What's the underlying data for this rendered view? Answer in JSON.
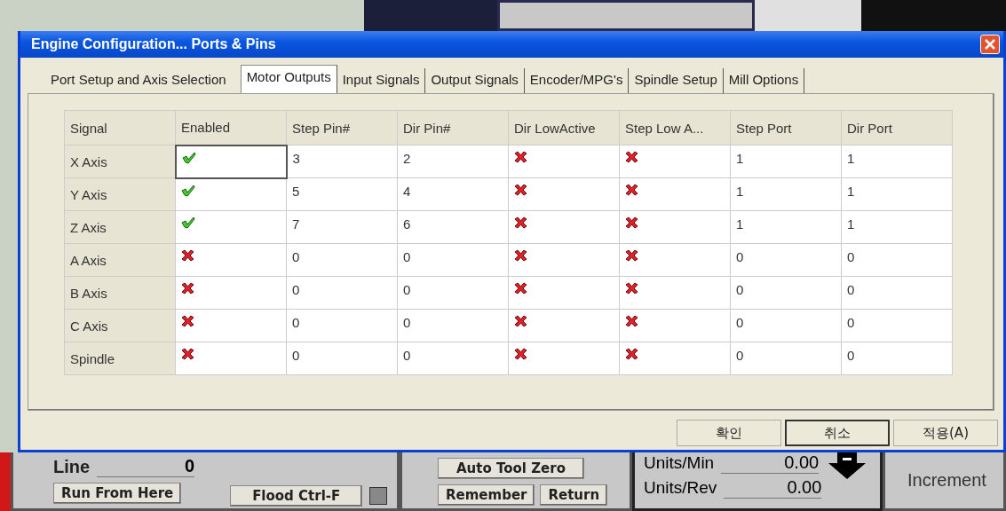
{
  "dialog": {
    "title": "Engine Configuration... Ports & Pins",
    "tabs": [
      {
        "label": "Port Setup and Axis Selection",
        "selected": false
      },
      {
        "label": "Motor Outputs",
        "selected": true
      },
      {
        "label": "Input Signals",
        "selected": false
      },
      {
        "label": "Output Signals",
        "selected": false
      },
      {
        "label": "Encoder/MPG's",
        "selected": false
      },
      {
        "label": "Spindle Setup",
        "selected": false
      },
      {
        "label": "Mill Options",
        "selected": false
      }
    ],
    "table": {
      "columns": [
        "Signal",
        "Enabled",
        "Step Pin#",
        "Dir Pin#",
        "Dir LowActive",
        "Step Low A...",
        "Step Port",
        "Dir Port"
      ],
      "rows": [
        {
          "selected": true,
          "cells": [
            {
              "kind": "label",
              "text": "X Axis"
            },
            {
              "kind": "flag",
              "on": true
            },
            {
              "kind": "text",
              "text": "3"
            },
            {
              "kind": "text",
              "text": "2"
            },
            {
              "kind": "flag",
              "on": false
            },
            {
              "kind": "flag",
              "on": false
            },
            {
              "kind": "text",
              "text": "1"
            },
            {
              "kind": "text",
              "text": "1"
            }
          ]
        },
        {
          "selected": false,
          "cells": [
            {
              "kind": "label",
              "text": "Y Axis"
            },
            {
              "kind": "flag",
              "on": true
            },
            {
              "kind": "text",
              "text": "5"
            },
            {
              "kind": "text",
              "text": "4"
            },
            {
              "kind": "flag",
              "on": false
            },
            {
              "kind": "flag",
              "on": false
            },
            {
              "kind": "text",
              "text": "1"
            },
            {
              "kind": "text",
              "text": "1"
            }
          ]
        },
        {
          "selected": false,
          "cells": [
            {
              "kind": "label",
              "text": "Z Axis"
            },
            {
              "kind": "flag",
              "on": true
            },
            {
              "kind": "text",
              "text": "7"
            },
            {
              "kind": "text",
              "text": "6"
            },
            {
              "kind": "flag",
              "on": false
            },
            {
              "kind": "flag",
              "on": false
            },
            {
              "kind": "text",
              "text": "1"
            },
            {
              "kind": "text",
              "text": "1"
            }
          ]
        },
        {
          "selected": false,
          "cells": [
            {
              "kind": "label",
              "text": "A Axis"
            },
            {
              "kind": "flag",
              "on": false
            },
            {
              "kind": "text",
              "text": "0"
            },
            {
              "kind": "text",
              "text": "0"
            },
            {
              "kind": "flag",
              "on": false
            },
            {
              "kind": "flag",
              "on": false
            },
            {
              "kind": "text",
              "text": "0"
            },
            {
              "kind": "text",
              "text": "0"
            }
          ]
        },
        {
          "selected": false,
          "cells": [
            {
              "kind": "label",
              "text": "B Axis"
            },
            {
              "kind": "flag",
              "on": false
            },
            {
              "kind": "text",
              "text": "0"
            },
            {
              "kind": "text",
              "text": "0"
            },
            {
              "kind": "flag",
              "on": false
            },
            {
              "kind": "flag",
              "on": false
            },
            {
              "kind": "text",
              "text": "0"
            },
            {
              "kind": "text",
              "text": "0"
            }
          ]
        },
        {
          "selected": false,
          "cells": [
            {
              "kind": "label",
              "text": "C Axis"
            },
            {
              "kind": "flag",
              "on": false
            },
            {
              "kind": "text",
              "text": "0"
            },
            {
              "kind": "text",
              "text": "0"
            },
            {
              "kind": "flag",
              "on": false
            },
            {
              "kind": "flag",
              "on": false
            },
            {
              "kind": "text",
              "text": "0"
            },
            {
              "kind": "text",
              "text": "0"
            }
          ]
        },
        {
          "selected": false,
          "cells": [
            {
              "kind": "label",
              "text": "Spindle"
            },
            {
              "kind": "flag",
              "on": false
            },
            {
              "kind": "text",
              "text": "0"
            },
            {
              "kind": "text",
              "text": "0"
            },
            {
              "kind": "flag",
              "on": false
            },
            {
              "kind": "flag",
              "on": false
            },
            {
              "kind": "text",
              "text": "0"
            },
            {
              "kind": "text",
              "text": "0"
            }
          ]
        }
      ]
    },
    "buttons": [
      {
        "label": "확인",
        "focused": false
      },
      {
        "label": "취소",
        "focused": true
      },
      {
        "label": "적용(A)",
        "focused": false
      }
    ]
  },
  "background_app": {
    "line_label": "Line",
    "line_value": "0",
    "run_from_here": "Run From Here",
    "flood": "Flood Ctrl-F",
    "auto_tool_zero": "Auto Tool Zero",
    "remember": "Remember",
    "return": "Return",
    "units_min_label": "Units/Min",
    "units_min_value": "0.00",
    "units_rev_label": "Units/Rev",
    "units_rev_value": "0.00",
    "increment_label": "Increment"
  }
}
